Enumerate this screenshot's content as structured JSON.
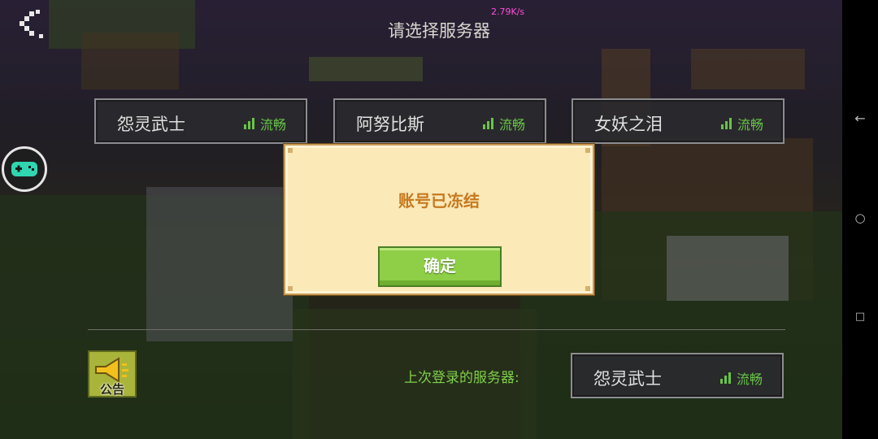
{
  "header": {
    "title": "请选择服务器",
    "net_speed": "2.79K/s"
  },
  "servers": [
    {
      "name": "怨灵武士",
      "status": "流畅"
    },
    {
      "name": "阿努比斯",
      "status": "流畅"
    },
    {
      "name": "女妖之泪",
      "status": "流畅"
    }
  ],
  "last_login": {
    "label": "上次登录的服务器:",
    "name": "怨灵武士",
    "status": "流畅"
  },
  "notice": {
    "label": "公告"
  },
  "dialog": {
    "message": "账号已冻结",
    "confirm_label": "确定"
  },
  "nav": {
    "back_glyph": "←",
    "home_glyph": "○",
    "recents_glyph": "□"
  },
  "colors": {
    "status_green": "#68c447",
    "confirm_green": "#8fcf48",
    "dialog_bg": "#fbe9b8",
    "dialog_text": "#c67a20"
  }
}
